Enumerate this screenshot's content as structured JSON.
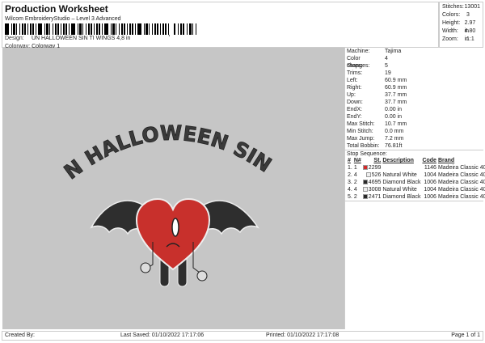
{
  "header": {
    "title": "Production Worksheet",
    "subtitle": "Wilcom EmbroideryStudio – Level 3 Advanced",
    "design_label": "Design:",
    "design_value": "UN HALLOWEEN SIN TI WINGS 4,8 in",
    "colorway_label": "Colorway:",
    "colorway_value": "Colorway 1"
  },
  "stats": [
    {
      "label": "Stitches:",
      "value": "13001"
    },
    {
      "label": "Colors:",
      "value": "3"
    },
    {
      "label": "Height:",
      "value": "2.97 in"
    },
    {
      "label": "Width:",
      "value": "4.80 in"
    },
    {
      "label": "Zoom:",
      "value": "1:1"
    }
  ],
  "info": [
    {
      "label": "Machine:",
      "value": "Tajima"
    },
    {
      "label": "Color changes:",
      "value": "4"
    },
    {
      "label": "Stops:",
      "value": "5"
    },
    {
      "label": "Trims:",
      "value": "19"
    },
    {
      "label": "Left:",
      "value": "60.9 mm"
    },
    {
      "label": "Right:",
      "value": "60.9 mm"
    },
    {
      "label": "Up:",
      "value": "37.7 mm"
    },
    {
      "label": "Down:",
      "value": "37.7 mm"
    },
    {
      "label": "EndX:",
      "value": "0.00 in"
    },
    {
      "label": "EndY:",
      "value": "0.00 in"
    },
    {
      "label": "Max Stitch:",
      "value": "10.7 mm"
    },
    {
      "label": "Min Stitch:",
      "value": "0.0 mm"
    },
    {
      "label": "Max Jump:",
      "value": "7.2 mm"
    },
    {
      "label": "Total Bobbin:",
      "value": "76.81ft"
    }
  ],
  "stop_sequence": {
    "title": "Stop Sequence:",
    "headers": [
      "#",
      "N#",
      "St.",
      "Description",
      "Code",
      "Brand"
    ],
    "rows": [
      {
        "num": "1.",
        "n": "1",
        "color": "#d42a2a",
        "st": "2299",
        "desc": "",
        "code": "1146",
        "brand": "Madeira Classic 40"
      },
      {
        "num": "2.",
        "n": "4",
        "color": "#eeeeee",
        "st": "526",
        "desc": "Natural White",
        "code": "1004",
        "brand": "Madeira Classic 40"
      },
      {
        "num": "3.",
        "n": "2",
        "color": "#2a2a2a",
        "st": "4695",
        "desc": "Diamond Black",
        "code": "1006",
        "brand": "Madeira Classic 40"
      },
      {
        "num": "4.",
        "n": "4",
        "color": "#eeeeee",
        "st": "3008",
        "desc": "Natural White",
        "code": "1004",
        "brand": "Madeira Classic 40"
      },
      {
        "num": "5.",
        "n": "2",
        "color": "#2a2a2a",
        "st": "2471",
        "desc": "Diamond Black",
        "code": "1006",
        "brand": "Madeira Classic 40"
      }
    ]
  },
  "artwork": {
    "text": "UN HALLOWEEN SIN TI"
  },
  "footer": {
    "created": "Created By:",
    "saved": "Last Saved: 01/10/2022 17:17:06",
    "printed": "Printed: 01/10/2022 17:17:08",
    "page": "Page 1 of 1"
  }
}
